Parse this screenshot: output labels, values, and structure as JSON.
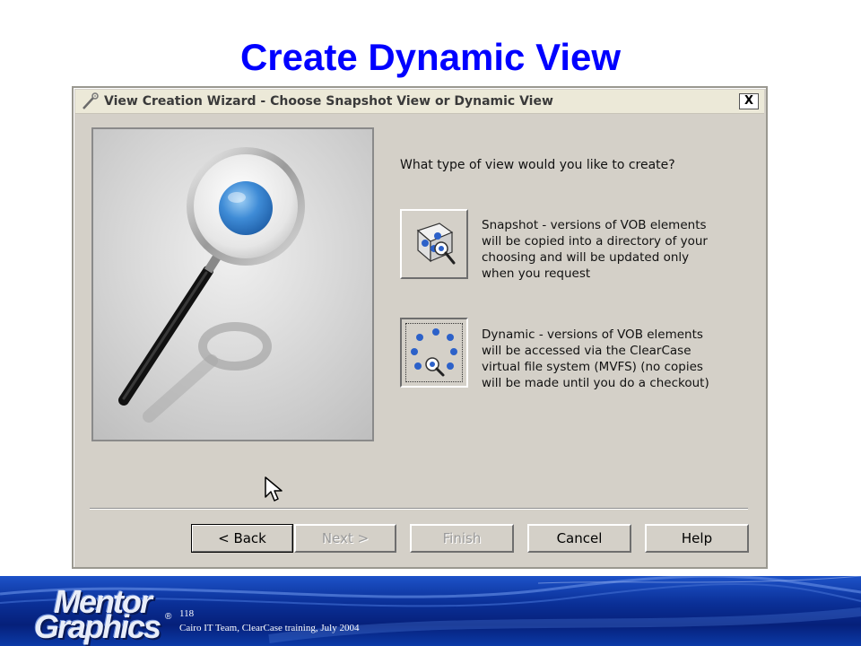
{
  "slide": {
    "title": "Create Dynamic View"
  },
  "dialog": {
    "title": "View Creation Wizard - Choose Snapshot View or Dynamic View",
    "close_label": "X",
    "question": "What type of view would you like to create?",
    "options": [
      {
        "id": "snapshot",
        "icon": "snapshot-view-icon",
        "selected": false,
        "lines": [
          "Snapshot - versions of VOB elements",
          "will be copied into a directory of your",
          "choosing and will be updated only",
          "when you request"
        ]
      },
      {
        "id": "dynamic",
        "icon": "dynamic-view-icon",
        "selected": true,
        "lines": [
          "Dynamic - versions of VOB elements",
          "will be accessed via the ClearCase",
          "virtual file system (MVFS) (no copies",
          "will be made until you do a checkout)"
        ]
      }
    ],
    "buttons": {
      "back": "< Back",
      "next": "Next >",
      "finish": "Finish",
      "cancel": "Cancel",
      "help": "Help"
    },
    "button_states": {
      "next": "disabled",
      "finish": "disabled",
      "back": "default"
    }
  },
  "footer": {
    "logo_top": "Mentor",
    "logo_bottom": "Graphics",
    "registered": "®",
    "page_number": "118",
    "caption": "Cairo IT Team, ClearCase training, July 2004"
  },
  "colors": {
    "title": "#0000ff",
    "dialog_face": "#d4d0c8",
    "footer_blue": "#0a2f96"
  }
}
